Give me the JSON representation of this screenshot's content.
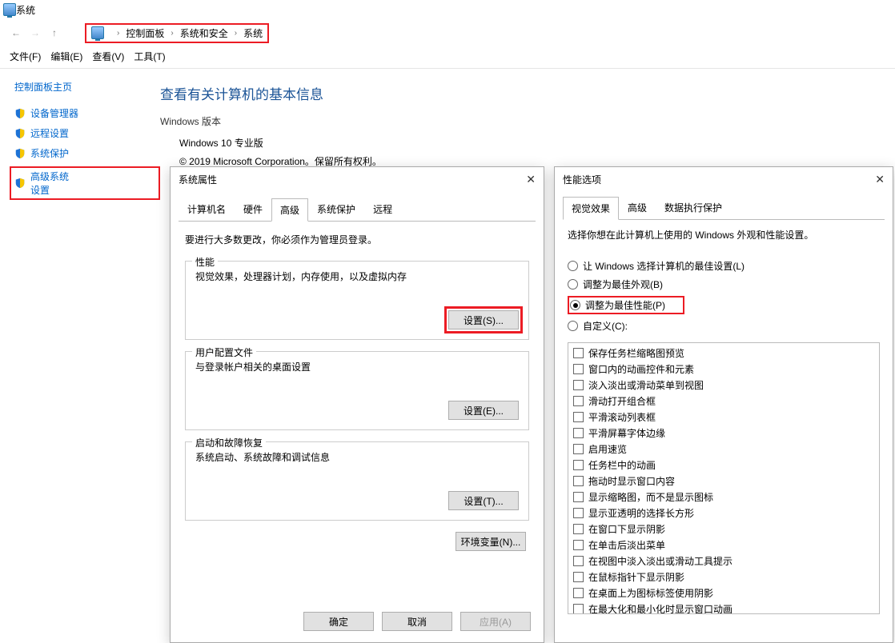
{
  "titlebar": {
    "title": "系统"
  },
  "breadcrumb": {
    "items": [
      "控制面板",
      "系统和安全",
      "系统"
    ]
  },
  "menubar": {
    "file": "文件(F)",
    "edit": "编辑(E)",
    "view": "查看(V)",
    "tools": "工具(T)"
  },
  "sidebar": {
    "home": "控制面板主页",
    "items": [
      "设备管理器",
      "远程设置",
      "系统保护",
      "高级系统设置"
    ]
  },
  "content": {
    "heading": "查看有关计算机的基本信息",
    "version_heading": "Windows 版本",
    "edition": "Windows 10 专业版",
    "copyright": "© 2019 Microsoft Corporation。保留所有权利。"
  },
  "dlg1": {
    "title": "系统属性",
    "tabs": [
      "计算机名",
      "硬件",
      "高级",
      "系统保护",
      "远程"
    ],
    "hint": "要进行大多数更改，你必须作为管理员登录。",
    "groups": {
      "perf": {
        "legend": "性能",
        "desc": "视觉效果，处理器计划，内存使用，以及虚拟内存",
        "btn": "设置(S)..."
      },
      "profile": {
        "legend": "用户配置文件",
        "desc": "与登录帐户相关的桌面设置",
        "btn": "设置(E)..."
      },
      "startup": {
        "legend": "启动和故障恢复",
        "desc": "系统启动、系统故障和调试信息",
        "btn": "设置(T)..."
      }
    },
    "env_btn": "环境变量(N)...",
    "footer": {
      "ok": "确定",
      "cancel": "取消",
      "apply": "应用(A)"
    }
  },
  "dlg2": {
    "title": "性能选项",
    "tabs": [
      "视觉效果",
      "高级",
      "数据执行保护"
    ],
    "hint": "选择你想在此计算机上使用的 Windows 外观和性能设置。",
    "radios": [
      "让 Windows 选择计算机的最佳设置(L)",
      "调整为最佳外观(B)",
      "调整为最佳性能(P)",
      "自定义(C):"
    ],
    "checks": [
      "保存任务栏缩略图预览",
      "窗口内的动画控件和元素",
      "淡入淡出或滑动菜单到视图",
      "滑动打开组合框",
      "平滑滚动列表框",
      "平滑屏幕字体边缘",
      "启用速览",
      "任务栏中的动画",
      "拖动时显示窗口内容",
      "显示缩略图，而不是显示图标",
      "显示亚透明的选择长方形",
      "在窗口下显示阴影",
      "在单击后淡出菜单",
      "在视图中淡入淡出或滑动工具提示",
      "在鼠标指针下显示阴影",
      "在桌面上为图标标签使用阴影",
      "在最大化和最小化时显示窗口动画"
    ]
  }
}
